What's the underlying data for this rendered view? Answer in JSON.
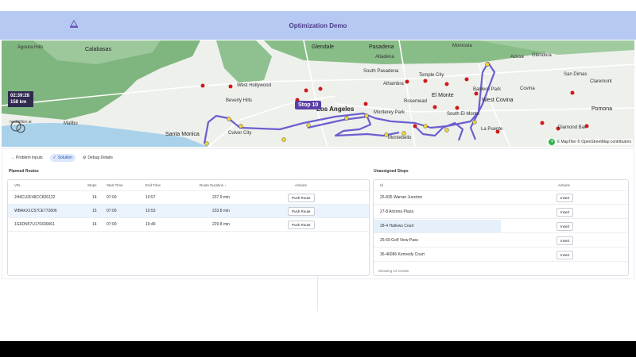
{
  "app": {
    "title": "Optimization Demo",
    "header_color": "#b6c9f2",
    "accent": "#5a3fa6"
  },
  "map": {
    "info_time": "02:39:28",
    "info_distance": "158 km",
    "stop_tooltip": "Stop 10",
    "brand_text": "nextbillion.ai",
    "attribution": "© MapTiler © OpenStreetMap contributors",
    "route_color": "#6b5fd0",
    "places": [
      {
        "name": "Agoura Hills",
        "cls": ""
      },
      {
        "name": "Calabasas",
        "cls": "mid"
      },
      {
        "name": "Glendale",
        "cls": "mid"
      },
      {
        "name": "Pasadena",
        "cls": "mid"
      },
      {
        "name": "Monrovia",
        "cls": ""
      },
      {
        "name": "Azusa",
        "cls": ""
      },
      {
        "name": "Glendora",
        "cls": ""
      },
      {
        "name": "Altadena",
        "cls": ""
      },
      {
        "name": "West Hollywood",
        "cls": ""
      },
      {
        "name": "South Pasadena",
        "cls": ""
      },
      {
        "name": "Temple City",
        "cls": ""
      },
      {
        "name": "Alhambra",
        "cls": ""
      },
      {
        "name": "San Dimas",
        "cls": ""
      },
      {
        "name": "Claremont",
        "cls": ""
      },
      {
        "name": "Baldwin Park",
        "cls": ""
      },
      {
        "name": "Covina",
        "cls": ""
      },
      {
        "name": "Beverly Hills",
        "cls": ""
      },
      {
        "name": "Rosemead",
        "cls": ""
      },
      {
        "name": "El Monte",
        "cls": "mid"
      },
      {
        "name": "West Covina",
        "cls": "mid"
      },
      {
        "name": "Pomona",
        "cls": "mid"
      },
      {
        "name": "Los Angeles",
        "cls": "big"
      },
      {
        "name": "Monterey Park",
        "cls": ""
      },
      {
        "name": "South El Monte",
        "cls": ""
      },
      {
        "name": "Malibu",
        "cls": ""
      },
      {
        "name": "Santa Monica",
        "cls": "mid"
      },
      {
        "name": "Culver City",
        "cls": ""
      },
      {
        "name": "Montebello",
        "cls": ""
      },
      {
        "name": "Diamond Bar",
        "cls": ""
      },
      {
        "name": "La Puente",
        "cls": ""
      }
    ]
  },
  "tabs": [
    {
      "label": "Problem Inputs",
      "icon": "→",
      "active": false
    },
    {
      "label": "Solution",
      "icon": "✓",
      "active": true
    },
    {
      "label": "Debug Details",
      "icon": "⚙",
      "active": false
    }
  ],
  "planned": {
    "title": "Planned Routes",
    "columns": [
      "VIN",
      "Stops",
      "Start Time",
      "End Time",
      "Route Duration ↓",
      "Actions"
    ],
    "rows": [
      {
        "vin": "JH4CU2F48CC826122",
        "stops": "14",
        "start": "07:00",
        "end": "10:57",
        "duration": "237.9 min",
        "action": "Push Route"
      },
      {
        "vin": "WBAKX1C57CE772806",
        "stops": "15",
        "start": "07:00",
        "end": "10:53",
        "duration": "233.8 min",
        "action": "Push Route"
      },
      {
        "vin": "1G6DN57U170430061",
        "stops": "14",
        "start": "07:00",
        "end": "10:49",
        "duration": "229.8 min",
        "action": "Push Route"
      }
    ]
  },
  "unassigned": {
    "title": "Unassigned Stops",
    "columns": [
      "Id",
      "Actions"
    ],
    "rows": [
      {
        "id": "25-835 Warner Junction",
        "action": "Insert"
      },
      {
        "id": "27-8 Arizona Plaza",
        "action": "Insert"
      },
      {
        "id": "28-4 Hallows Court",
        "action": "Insert"
      },
      {
        "id": "25-69 Golf View Pass",
        "action": "Insert"
      },
      {
        "id": "36-46086 Kennedy Court",
        "action": "Insert"
      }
    ],
    "footer": "Showing 13 results"
  }
}
